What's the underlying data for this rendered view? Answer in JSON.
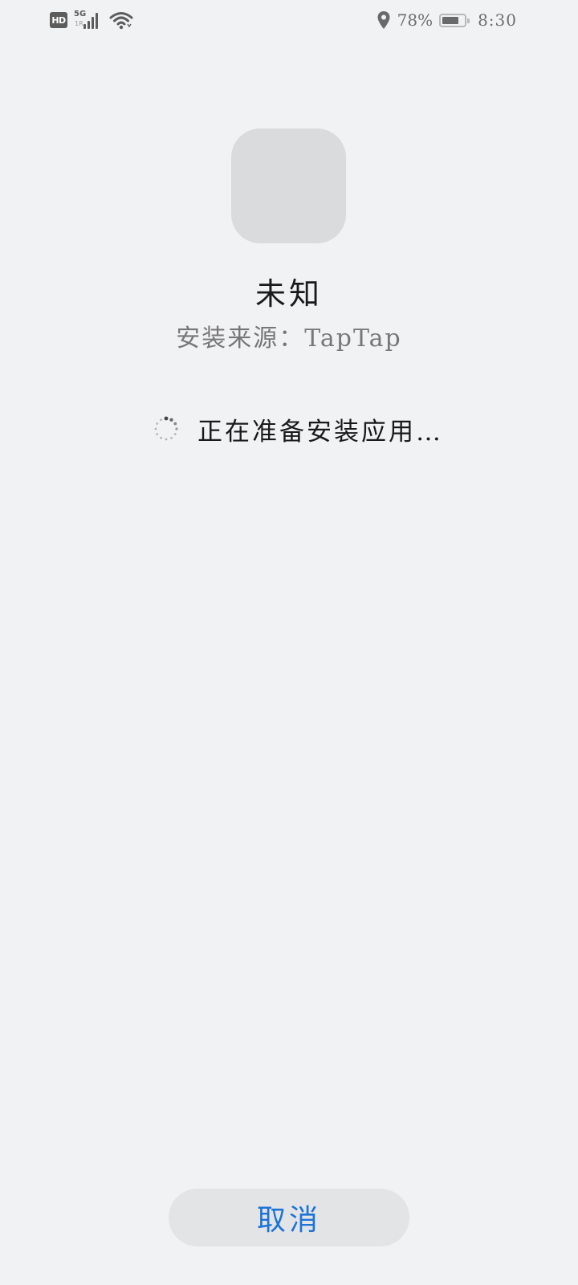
{
  "status_bar": {
    "hd_label": "HD",
    "network_type": "5G",
    "network_sub": "1R",
    "signal_icon": "signal-bars-icon",
    "wifi_icon": "wifi-icon",
    "location_icon": "location-pin-icon",
    "battery_percent": "78%",
    "battery_level": 0.78,
    "time": "8:30"
  },
  "app": {
    "icon_placeholder_color": "#dadbdd",
    "name": "未知",
    "install_source": "安装来源：TapTap"
  },
  "progress": {
    "spinner_icon": "loading-spinner-icon",
    "status_text": "正在准备安装应用…"
  },
  "actions": {
    "cancel_label": "取消",
    "accent_color": "#1d73d6"
  }
}
